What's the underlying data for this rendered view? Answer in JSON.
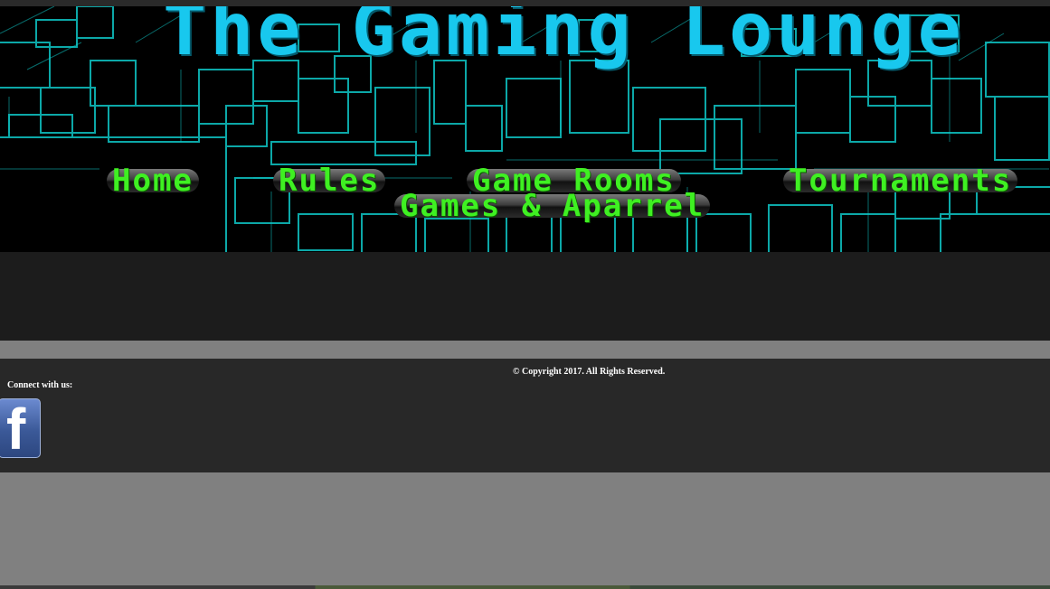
{
  "header": {
    "title": "The Gaming Lounge",
    "accent_color": "#18c8ee"
  },
  "nav": {
    "items": [
      {
        "label": "Home"
      },
      {
        "label": "Rules"
      },
      {
        "label": "Game Rooms"
      },
      {
        "label": "Tournaments"
      },
      {
        "label": "Games & Aparrel"
      }
    ],
    "text_color": "#3ff022"
  },
  "footer": {
    "copyright": "© Copyright 2017. All Rights Reserved.",
    "connect_label": "Connect with us:",
    "facebook_icon": "facebook-icon",
    "facebook_glyph": "f"
  }
}
